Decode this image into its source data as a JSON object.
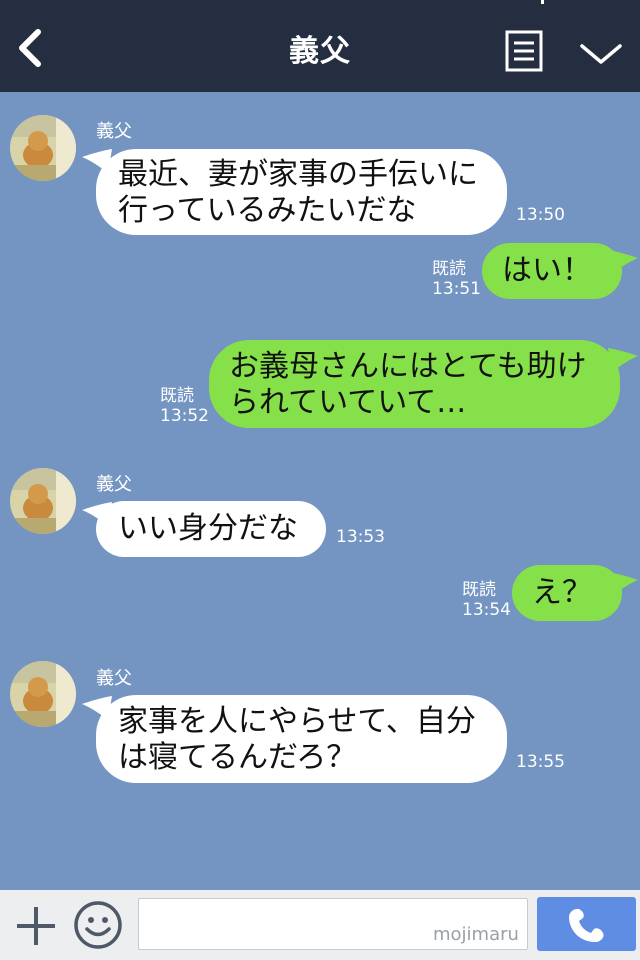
{
  "header": {
    "title": "義父"
  },
  "messages": [
    {
      "sender": "義父",
      "text": "最近、妻が家事の手伝いに\n行っているみたいだな",
      "time": "13:50"
    },
    {
      "text": "はい！",
      "read": "既読",
      "time": "13:51"
    },
    {
      "text": "お義母さんにはとても助け\nられていていて…",
      "read": "既読",
      "time": "13:52"
    },
    {
      "sender": "義父",
      "text": "いい身分だな",
      "time": "13:53"
    },
    {
      "text": "え？",
      "read": "既読",
      "time": "13:54"
    },
    {
      "sender": "義父",
      "text": "家事を人にやらせて、自分\nは寝てるんだろ？",
      "time": "13:55"
    }
  ],
  "footer": {
    "input_value": "",
    "watermark": "mojimaru"
  },
  "icons": {
    "back": "chevron-left-icon",
    "menu": "note-icon",
    "collapse": "chevron-down-icon",
    "add": "plus-icon",
    "sticker": "smiley-icon",
    "call": "phone-icon"
  },
  "colors": {
    "header_bg": "#252d40",
    "chat_bg": "#7494c1",
    "incoming_bubble": "#ffffff",
    "outgoing_bubble": "#86e04a",
    "call_button": "#5e8de3"
  }
}
